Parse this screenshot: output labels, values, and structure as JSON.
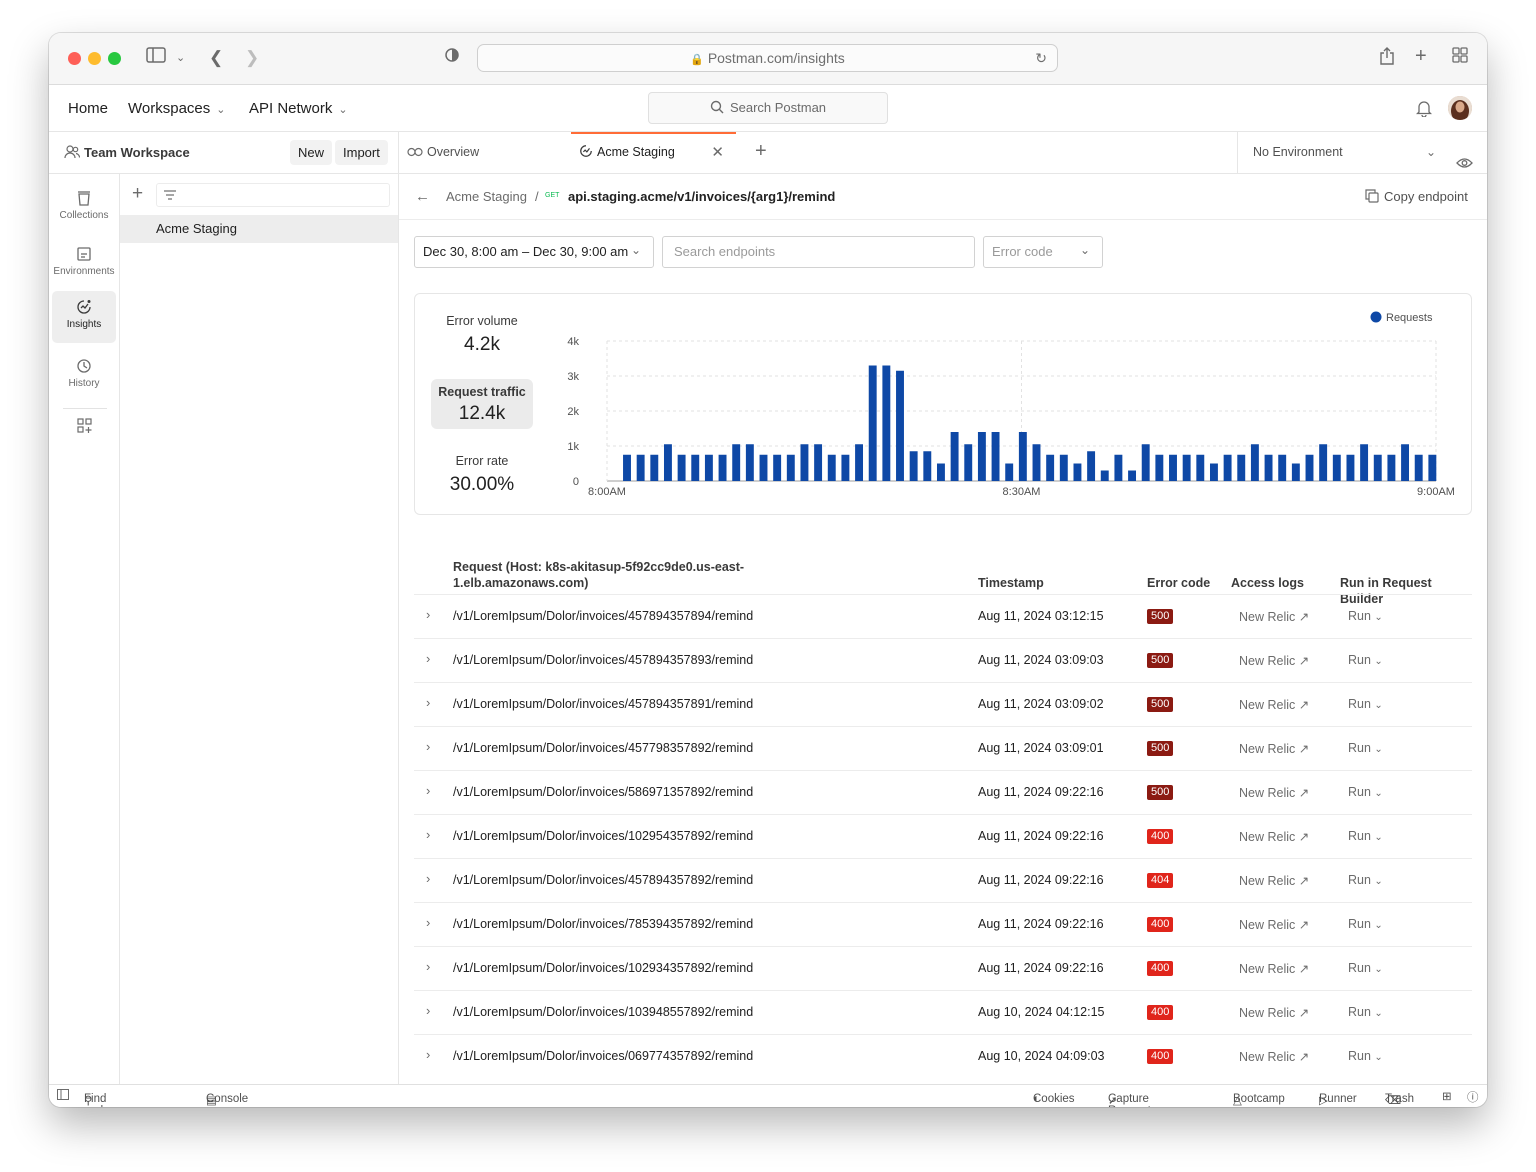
{
  "browser": {
    "url": "Postman.com/insights"
  },
  "nav": {
    "home": "Home",
    "workspaces": "Workspaces",
    "api_network": "API Network",
    "search_placeholder": "Search Postman"
  },
  "workspace": {
    "name": "Team Workspace",
    "new_label": "New",
    "import_label": "Import",
    "selected_item": "Acme Staging"
  },
  "rail": {
    "items": [
      {
        "label": "Collections",
        "icon": "collections-icon"
      },
      {
        "label": "Environments",
        "icon": "environments-icon"
      },
      {
        "label": "Insights",
        "icon": "insights-icon"
      },
      {
        "label": "History",
        "icon": "history-icon"
      }
    ]
  },
  "tabs": {
    "overview": "Overview",
    "active": "Acme Staging",
    "environment": "No Environment"
  },
  "breadcrumb": {
    "parent": "Acme Staging",
    "separator": "/",
    "method": "GET",
    "endpoint": "api.staging.acme/v1/invoices/{arg1}/remind",
    "copy_label": "Copy endpoint"
  },
  "filters": {
    "date_range": "Dec 30, 8:00 am – Dec 30, 9:00 am",
    "search_placeholder": "Search endpoints",
    "error_code_placeholder": "Error code"
  },
  "stats": {
    "error_volume_label": "Error volume",
    "error_volume_value": "4.2k",
    "request_traffic_label": "Request traffic",
    "request_traffic_value": "12.4k",
    "error_rate_label": "Error rate",
    "error_rate_value": "30.00%"
  },
  "chart_data": {
    "type": "bar",
    "legend": "Requests",
    "legend_position": "top-right",
    "bar_color": "#0e48a6",
    "y_ticks": [
      "4k",
      "3k",
      "2k",
      "1k",
      "0"
    ],
    "ylim": [
      0,
      4000
    ],
    "x_ticks": [
      "8:00AM",
      "8:30AM",
      "9:00AM"
    ],
    "grid": true,
    "values": [
      750,
      750,
      750,
      1050,
      750,
      750,
      750,
      750,
      1050,
      1050,
      750,
      750,
      750,
      1050,
      1050,
      750,
      750,
      1050,
      3300,
      3300,
      3150,
      850,
      850,
      500,
      1400,
      1050,
      1400,
      1400,
      500,
      1400,
      1050,
      750,
      750,
      500,
      850,
      300,
      750,
      300,
      1050,
      750,
      750,
      750,
      750,
      500,
      750,
      750,
      1050,
      750,
      750,
      500,
      750,
      1050,
      750,
      750,
      1050,
      750,
      750,
      1050,
      750,
      750
    ]
  },
  "table": {
    "headers": {
      "request": "Request (Host: k8s-akitasup-5f92cc9de0.us-east-1.elb.amazonaws.com)",
      "timestamp": "Timestamp",
      "error_code": "Error code",
      "access_logs": "Access logs",
      "run": "Run in Request Builder"
    },
    "rows": [
      {
        "path": "/v1/LoremIpsum/Dolor/invoices/457894357894/remind",
        "ts": "Aug 11, 2024 03:12:15",
        "code": "500",
        "color": "#8b1a12",
        "logs": "New Relic",
        "run": "Run"
      },
      {
        "path": "/v1/LoremIpsum/Dolor/invoices/457894357893/remind",
        "ts": "Aug 11, 2024 03:09:03",
        "code": "500",
        "color": "#8b1a12",
        "logs": "New Relic",
        "run": "Run"
      },
      {
        "path": "/v1/LoremIpsum/Dolor/invoices/457894357891/remind",
        "ts": "Aug 11, 2024 03:09:02",
        "code": "500",
        "color": "#8b1a12",
        "logs": "New Relic",
        "run": "Run"
      },
      {
        "path": "/v1/LoremIpsum/Dolor/invoices/457798357892/remind",
        "ts": "Aug 11, 2024 03:09:01",
        "code": "500",
        "color": "#8b1a12",
        "logs": "New Relic",
        "run": "Run"
      },
      {
        "path": "/v1/LoremIpsum/Dolor/invoices/586971357892/remind",
        "ts": "Aug 11, 2024 09:22:16",
        "code": "500",
        "color": "#8b1a12",
        "logs": "New Relic",
        "run": "Run"
      },
      {
        "path": "/v1/LoremIpsum/Dolor/invoices/102954357892/remind",
        "ts": "Aug 11, 2024 09:22:16",
        "code": "400",
        "color": "#e0251b",
        "logs": "New Relic",
        "run": "Run"
      },
      {
        "path": "/v1/LoremIpsum/Dolor/invoices/457894357892/remind",
        "ts": "Aug 11, 2024 09:22:16",
        "code": "404",
        "color": "#e0251b",
        "logs": "New Relic",
        "run": "Run"
      },
      {
        "path": "/v1/LoremIpsum/Dolor/invoices/785394357892/remind",
        "ts": "Aug 11, 2024 09:22:16",
        "code": "400",
        "color": "#e0251b",
        "logs": "New Relic",
        "run": "Run"
      },
      {
        "path": "/v1/LoremIpsum/Dolor/invoices/102934357892/remind",
        "ts": "Aug 11, 2024 09:22:16",
        "code": "400",
        "color": "#e0251b",
        "logs": "New Relic",
        "run": "Run"
      },
      {
        "path": "/v1/LoremIpsum/Dolor/invoices/103948557892/remind",
        "ts": "Aug 10, 2024 04:12:15",
        "code": "400",
        "color": "#e0251b",
        "logs": "New Relic",
        "run": "Run"
      },
      {
        "path": "/v1/LoremIpsum/Dolor/invoices/069774357892/remind",
        "ts": "Aug 10, 2024 04:09:03",
        "code": "400",
        "color": "#e0251b",
        "logs": "New Relic",
        "run": "Run"
      }
    ]
  },
  "footer": {
    "find_replace": "Find and Replace",
    "console": "Console",
    "cookies": "Cookies",
    "capture": "Capture Requests",
    "bootcamp": "Bootcamp",
    "runner": "Runner",
    "trash": "Trash"
  }
}
